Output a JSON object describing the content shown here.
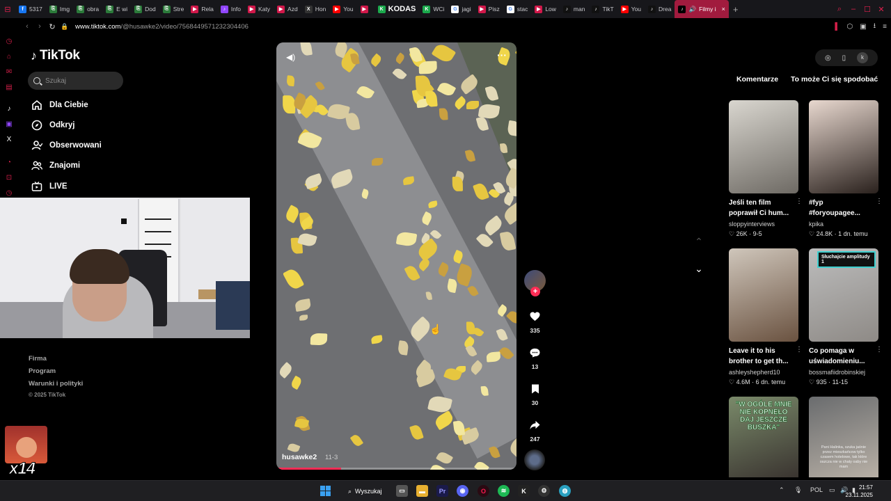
{
  "browser": {
    "tabs": [
      {
        "label": "5317",
        "color": "#1877f2",
        "glyph": "f"
      },
      {
        "label": "Img",
        "color": "#2b7a3a",
        "glyph": "⎘"
      },
      {
        "label": "obra",
        "color": "#2b7a3a",
        "glyph": "⎘"
      },
      {
        "label": "E wi",
        "color": "#2b7a3a",
        "glyph": "⎘"
      },
      {
        "label": "Dod",
        "color": "#2b7a3a",
        "glyph": "⎘"
      },
      {
        "label": "Stre",
        "color": "#2b7a3a",
        "glyph": "⎘"
      },
      {
        "label": "Rela",
        "color": "#d1184a",
        "glyph": "▶"
      },
      {
        "label": "Info",
        "color": "#9146ff",
        "glyph": "♪"
      },
      {
        "label": "Katy",
        "color": "#d1184a",
        "glyph": "▶"
      },
      {
        "label": "Azd",
        "color": "#d1184a",
        "glyph": "▶"
      },
      {
        "label": "Hon",
        "color": "#333",
        "glyph": "X"
      },
      {
        "label": "You",
        "color": "#ff0000",
        "glyph": "▶"
      },
      {
        "label": "",
        "color": "#d1184a",
        "glyph": "▶"
      },
      {
        "label": "KODAS",
        "color": "#1ba94c",
        "glyph": "K"
      },
      {
        "label": "WCi",
        "color": "#1ba94c",
        "glyph": "K"
      },
      {
        "label": "jagi",
        "color": "#fff",
        "glyph": "G"
      },
      {
        "label": "Pisz",
        "color": "#d1184a",
        "glyph": "▶"
      },
      {
        "label": "stac",
        "color": "#fff",
        "glyph": "G"
      },
      {
        "label": "Low",
        "color": "#d1184a",
        "glyph": "▶"
      },
      {
        "label": "man",
        "color": "#111",
        "glyph": "♪"
      },
      {
        "label": "TikT",
        "color": "#111",
        "glyph": "♪"
      },
      {
        "label": "You",
        "color": "#ff0000",
        "glyph": "▶"
      },
      {
        "label": "Drea",
        "color": "#111",
        "glyph": "♪"
      }
    ],
    "active_tab": "Filmy i",
    "url_host": "www.tiktok.com",
    "url_path": "/@husawke2/video/7568449571232304406"
  },
  "tiktok": {
    "logo": "TikTok",
    "search_placeholder": "Szukaj",
    "nav": [
      {
        "label": "Dla Ciebie",
        "icon": "home-icon"
      },
      {
        "label": "Odkryj",
        "icon": "compass-icon"
      },
      {
        "label": "Obserwowani",
        "icon": "following-icon"
      },
      {
        "label": "Znajomi",
        "icon": "friends-icon"
      },
      {
        "label": "LIVE",
        "icon": "live-icon"
      }
    ],
    "footer": [
      "Firma",
      "Program",
      "Warunki i polityki"
    ],
    "copyright": "© 2025 TikTok"
  },
  "overlay": {
    "emote_count": "x14"
  },
  "video": {
    "author": "husawke2",
    "date": "11-3",
    "progress": 0.27,
    "likes": "335",
    "comments": "13",
    "saves": "30",
    "shares": "247"
  },
  "panel": {
    "tab_comments": "Komentarze",
    "tab_related": "To może Ci się spodobać",
    "cards": [
      {
        "title": "Jeśli ten film poprawił Ci hum...",
        "user": "sloppyinterviews",
        "likes": "26K",
        "date": "9-5",
        "thumb_a": "#d9d6cf",
        "thumb_b": "#6e6a64",
        "overlay": ""
      },
      {
        "title": "#fyp #foryoupagee...",
        "user": "kpika",
        "likes": "24.8K",
        "date": "1 dn. temu",
        "thumb_a": "#e8d8cf",
        "thumb_b": "#2a211d",
        "overlay": ""
      },
      {
        "title": "Leave it to his brother to get th...",
        "user": "ashleyshepherd10",
        "likes": "4.6M",
        "date": "6 dn. temu",
        "thumb_a": "#cfc6bb",
        "thumb_b": "#6a5240",
        "overlay": ""
      },
      {
        "title": "Co pomaga w uświadomieniu...",
        "user": "bossmafiidrobinskiej",
        "likes": "935",
        "date": "11-15",
        "thumb_a": "#bdbdbd",
        "thumb_b": "#8e8a86",
        "overlay": "Słuchajcie amplitudy 1"
      },
      {
        "title": "",
        "user": "",
        "likes": "",
        "date": "",
        "thumb_a": "#7a8a6a",
        "thumb_b": "#3a3430",
        "overlay": "\"W OGÓLE MNIE NIE KOPNĘŁO DAJ JESZCZE BUSZKA\""
      },
      {
        "title": "",
        "user": "",
        "likes": "",
        "date": "",
        "thumb_a": "#6a6c6e",
        "thumb_b": "#b8b0a6",
        "overlay": "Pani Halinka, szuka jaśnie przez mieszkańcow tylko czasem hotelowe, tak które oszcza nie w chaty oaby nie mam"
      }
    ]
  },
  "taskbar": {
    "search_label": "Wyszukaj",
    "lang": "POL",
    "time": "21:57",
    "date": "23.11.2025"
  }
}
